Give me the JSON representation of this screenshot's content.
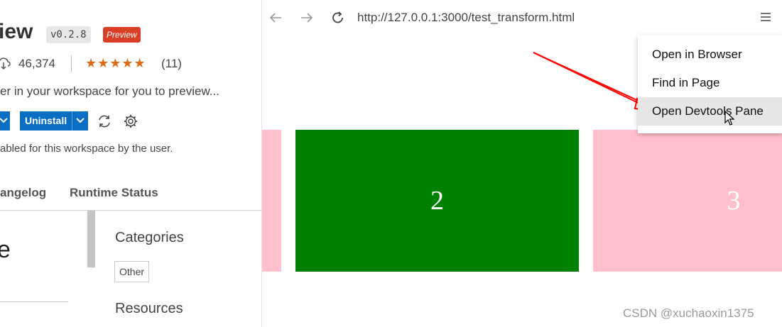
{
  "extension": {
    "name_fragment": "iew",
    "version": "v0.2.8",
    "preview_badge": "Preview",
    "downloads": "46,374",
    "stars": "★★★★★",
    "rating_count": "(11)",
    "description": "er in your workspace for you to preview...",
    "uninstall_label": "Uninstall",
    "status_text": "abled for this workspace by the user.",
    "tabs": [
      {
        "label": "angelog"
      },
      {
        "label": "Runtime Status"
      }
    ],
    "readme_glyph": "e",
    "categories_title": "Categories",
    "category_tag": "Other",
    "resources_title": "Resources"
  },
  "browser": {
    "url": "http://127.0.0.1:3000/test_transform.html",
    "boxes": [
      {
        "label": ""
      },
      {
        "label": "2"
      },
      {
        "label": "3"
      }
    ],
    "menu": [
      {
        "label": "Open in Browser"
      },
      {
        "label": "Find in Page"
      },
      {
        "label": "Open Devtools Pane"
      }
    ],
    "annotation_color": "#ff0000"
  },
  "watermark": "CSDN @xuchaoxin1375",
  "colors": {
    "accent_button": "#0a6fc2",
    "preview_badge": "#d93f26",
    "stars": "#df6a16",
    "box_green": "#008000",
    "box_pink": "#ffc0cb"
  },
  "icons": [
    "cloud-download-icon",
    "chevron-down-icon",
    "sync-icon",
    "gear-icon",
    "back-arrow-icon",
    "forward-arrow-icon",
    "reload-icon",
    "hamburger-menu-icon",
    "mouse-cursor-icon"
  ]
}
